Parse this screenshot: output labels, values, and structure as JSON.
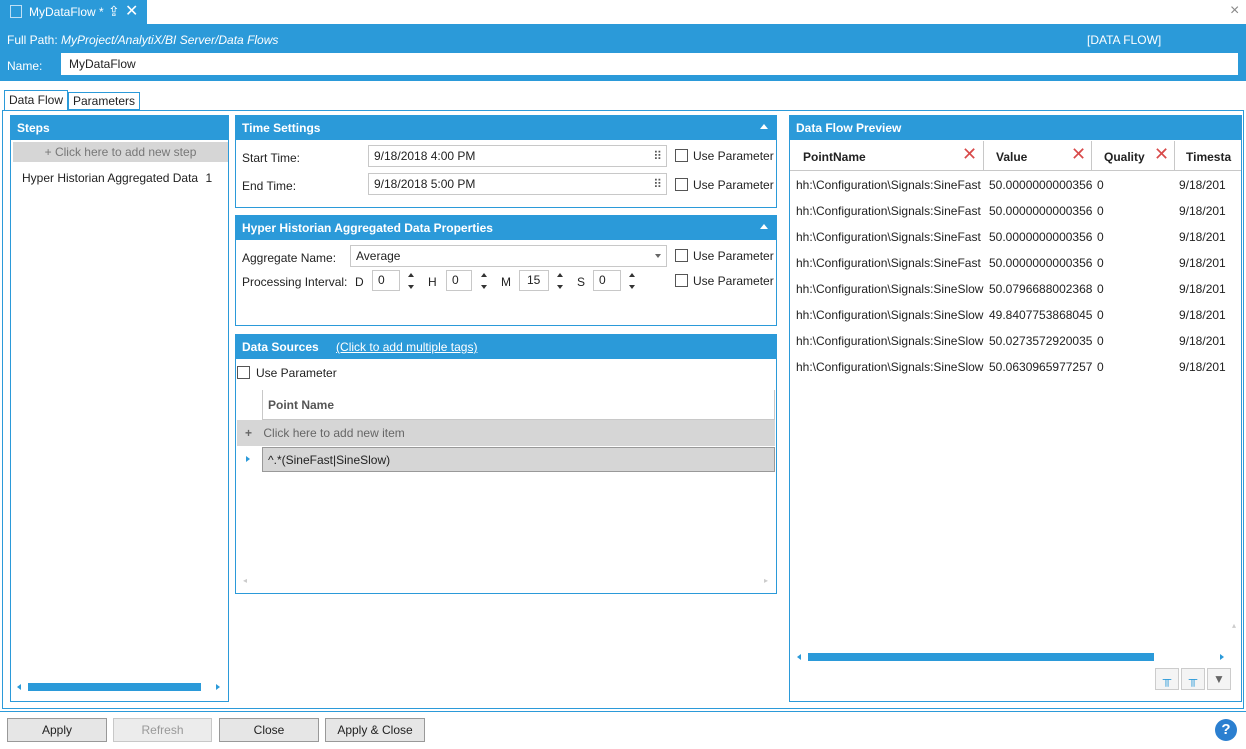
{
  "window": {
    "tab_title": "MyDataFlow *",
    "pin_icon": "pin-icon",
    "close_icon": "close-icon",
    "window_close": "×"
  },
  "header": {
    "full_path_label": "Full Path:",
    "full_path_value": "MyProject/AnalytiX/BI Server/Data Flows",
    "type_badge": "[DATA FLOW]",
    "name_label": "Name:",
    "name_value": "MyDataFlow"
  },
  "tabs": [
    {
      "label": "Data Flow",
      "active": true
    },
    {
      "label": "Parameters",
      "active": false
    }
  ],
  "steps": {
    "title": "Steps",
    "add_label": "+ Click here to add new step",
    "items": [
      {
        "label": "Hyper Historian Aggregated Data",
        "index": "1"
      }
    ]
  },
  "time_settings": {
    "title": "Time Settings",
    "start_label": "Start Time:",
    "start_value": "9/18/2018 4:00 PM",
    "end_label": "End Time:",
    "end_value": "9/18/2018 5:00 PM",
    "use_parameter": "Use Parameter"
  },
  "hh_props": {
    "title": "Hyper Historian Aggregated Data Properties",
    "aggregate_label": "Aggregate Name:",
    "aggregate_value": "Average",
    "interval_label": "Processing Interval:",
    "d_label": "D",
    "d_value": "0",
    "h_label": "H",
    "h_value": "0",
    "m_label": "M",
    "m_value": "15",
    "s_label": "S",
    "s_value": "0",
    "use_parameter": "Use Parameter"
  },
  "data_sources": {
    "title": "Data Sources",
    "link": "(Click to add multiple tags)",
    "use_parameter": "Use Parameter",
    "column_header": "Point Name",
    "add_label": "Click here to add new item",
    "items": [
      "^.*(SineFast|SineSlow)"
    ]
  },
  "preview": {
    "title": "Data Flow Preview",
    "columns": [
      "PointName",
      "Value",
      "Quality",
      "Timesta"
    ],
    "rows": [
      [
        "hh:\\Configuration\\Signals:SineFast",
        "50.0000000000356",
        "0",
        "9/18/201"
      ],
      [
        "hh:\\Configuration\\Signals:SineFast",
        "50.0000000000356",
        "0",
        "9/18/201"
      ],
      [
        "hh:\\Configuration\\Signals:SineFast",
        "50.0000000000356",
        "0",
        "9/18/201"
      ],
      [
        "hh:\\Configuration\\Signals:SineFast",
        "50.0000000000356",
        "0",
        "9/18/201"
      ],
      [
        "hh:\\Configuration\\Signals:SineSlow",
        "50.0796688002368",
        "0",
        "9/18/201"
      ],
      [
        "hh:\\Configuration\\Signals:SineSlow",
        "49.8407753868045",
        "0",
        "9/18/201"
      ],
      [
        "hh:\\Configuration\\Signals:SineSlow",
        "50.0273572920035",
        "0",
        "9/18/201"
      ],
      [
        "hh:\\Configuration\\Signals:SineSlow",
        "50.0630965977257",
        "0",
        "9/18/201"
      ]
    ]
  },
  "footer": {
    "apply": "Apply",
    "refresh": "Refresh",
    "close": "Close",
    "apply_close": "Apply & Close",
    "help": "?"
  }
}
